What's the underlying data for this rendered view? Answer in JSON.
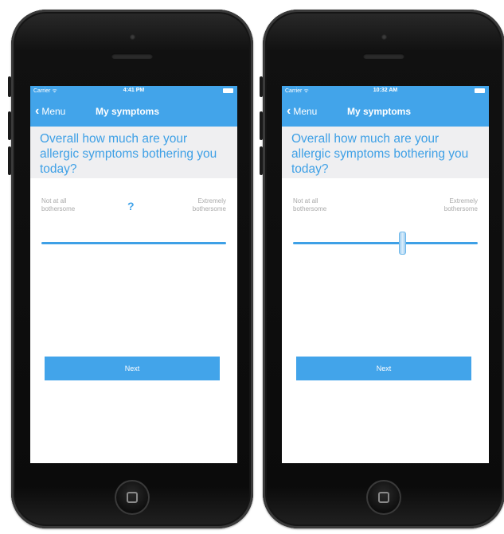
{
  "phones": [
    {
      "status": {
        "carrier": "Carrier ᯤ",
        "time": "4:41 PM"
      },
      "nav": {
        "back_label": "Menu",
        "title": "My symptoms"
      },
      "question": "Overall how much are your allergic symptoms bothering you today?",
      "scale": {
        "min_label": "Not at all bothersome",
        "max_label": "Extremely bothersome",
        "unset_marker": "?",
        "value": null
      },
      "next_label": "Next"
    },
    {
      "status": {
        "carrier": "Carrier ᯤ",
        "time": "10:32 AM"
      },
      "nav": {
        "back_label": "Menu",
        "title": "My symptoms"
      },
      "question": "Overall how much are your allergic symptoms bothering you today?",
      "scale": {
        "min_label": "Not at all bothersome",
        "max_label": "Extremely bothersome",
        "value": 0.59
      },
      "next_label": "Next"
    }
  ],
  "colors": {
    "accent": "#42a4ea",
    "question_band": "#efeff1",
    "label_gray": "#aaaaaa"
  },
  "icons": {
    "back": "chevron-left-icon",
    "battery": "battery-icon",
    "home": "home-button-icon"
  }
}
